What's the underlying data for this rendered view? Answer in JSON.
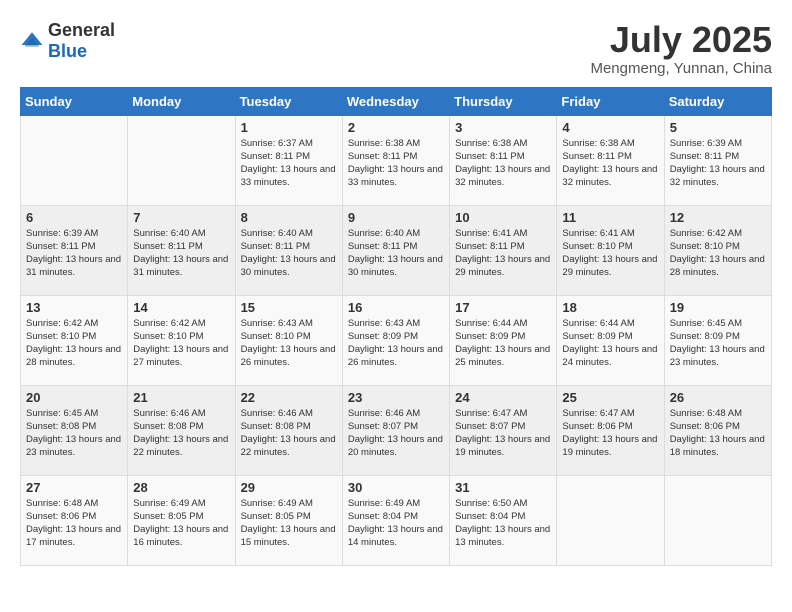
{
  "logo": {
    "general": "General",
    "blue": "Blue"
  },
  "header": {
    "month_year": "July 2025",
    "location": "Mengmeng, Yunnan, China"
  },
  "days_of_week": [
    "Sunday",
    "Monday",
    "Tuesday",
    "Wednesday",
    "Thursday",
    "Friday",
    "Saturday"
  ],
  "weeks": [
    [
      {
        "day": "",
        "sunrise": "",
        "sunset": "",
        "daylight": ""
      },
      {
        "day": "",
        "sunrise": "",
        "sunset": "",
        "daylight": ""
      },
      {
        "day": "1",
        "sunrise": "Sunrise: 6:37 AM",
        "sunset": "Sunset: 8:11 PM",
        "daylight": "Daylight: 13 hours and 33 minutes."
      },
      {
        "day": "2",
        "sunrise": "Sunrise: 6:38 AM",
        "sunset": "Sunset: 8:11 PM",
        "daylight": "Daylight: 13 hours and 33 minutes."
      },
      {
        "day": "3",
        "sunrise": "Sunrise: 6:38 AM",
        "sunset": "Sunset: 8:11 PM",
        "daylight": "Daylight: 13 hours and 32 minutes."
      },
      {
        "day": "4",
        "sunrise": "Sunrise: 6:38 AM",
        "sunset": "Sunset: 8:11 PM",
        "daylight": "Daylight: 13 hours and 32 minutes."
      },
      {
        "day": "5",
        "sunrise": "Sunrise: 6:39 AM",
        "sunset": "Sunset: 8:11 PM",
        "daylight": "Daylight: 13 hours and 32 minutes."
      }
    ],
    [
      {
        "day": "6",
        "sunrise": "Sunrise: 6:39 AM",
        "sunset": "Sunset: 8:11 PM",
        "daylight": "Daylight: 13 hours and 31 minutes."
      },
      {
        "day": "7",
        "sunrise": "Sunrise: 6:40 AM",
        "sunset": "Sunset: 8:11 PM",
        "daylight": "Daylight: 13 hours and 31 minutes."
      },
      {
        "day": "8",
        "sunrise": "Sunrise: 6:40 AM",
        "sunset": "Sunset: 8:11 PM",
        "daylight": "Daylight: 13 hours and 30 minutes."
      },
      {
        "day": "9",
        "sunrise": "Sunrise: 6:40 AM",
        "sunset": "Sunset: 8:11 PM",
        "daylight": "Daylight: 13 hours and 30 minutes."
      },
      {
        "day": "10",
        "sunrise": "Sunrise: 6:41 AM",
        "sunset": "Sunset: 8:11 PM",
        "daylight": "Daylight: 13 hours and 29 minutes."
      },
      {
        "day": "11",
        "sunrise": "Sunrise: 6:41 AM",
        "sunset": "Sunset: 8:10 PM",
        "daylight": "Daylight: 13 hours and 29 minutes."
      },
      {
        "day": "12",
        "sunrise": "Sunrise: 6:42 AM",
        "sunset": "Sunset: 8:10 PM",
        "daylight": "Daylight: 13 hours and 28 minutes."
      }
    ],
    [
      {
        "day": "13",
        "sunrise": "Sunrise: 6:42 AM",
        "sunset": "Sunset: 8:10 PM",
        "daylight": "Daylight: 13 hours and 28 minutes."
      },
      {
        "day": "14",
        "sunrise": "Sunrise: 6:42 AM",
        "sunset": "Sunset: 8:10 PM",
        "daylight": "Daylight: 13 hours and 27 minutes."
      },
      {
        "day": "15",
        "sunrise": "Sunrise: 6:43 AM",
        "sunset": "Sunset: 8:10 PM",
        "daylight": "Daylight: 13 hours and 26 minutes."
      },
      {
        "day": "16",
        "sunrise": "Sunrise: 6:43 AM",
        "sunset": "Sunset: 8:09 PM",
        "daylight": "Daylight: 13 hours and 26 minutes."
      },
      {
        "day": "17",
        "sunrise": "Sunrise: 6:44 AM",
        "sunset": "Sunset: 8:09 PM",
        "daylight": "Daylight: 13 hours and 25 minutes."
      },
      {
        "day": "18",
        "sunrise": "Sunrise: 6:44 AM",
        "sunset": "Sunset: 8:09 PM",
        "daylight": "Daylight: 13 hours and 24 minutes."
      },
      {
        "day": "19",
        "sunrise": "Sunrise: 6:45 AM",
        "sunset": "Sunset: 8:09 PM",
        "daylight": "Daylight: 13 hours and 23 minutes."
      }
    ],
    [
      {
        "day": "20",
        "sunrise": "Sunrise: 6:45 AM",
        "sunset": "Sunset: 8:08 PM",
        "daylight": "Daylight: 13 hours and 23 minutes."
      },
      {
        "day": "21",
        "sunrise": "Sunrise: 6:46 AM",
        "sunset": "Sunset: 8:08 PM",
        "daylight": "Daylight: 13 hours and 22 minutes."
      },
      {
        "day": "22",
        "sunrise": "Sunrise: 6:46 AM",
        "sunset": "Sunset: 8:08 PM",
        "daylight": "Daylight: 13 hours and 22 minutes."
      },
      {
        "day": "23",
        "sunrise": "Sunrise: 6:46 AM",
        "sunset": "Sunset: 8:07 PM",
        "daylight": "Daylight: 13 hours and 20 minutes."
      },
      {
        "day": "24",
        "sunrise": "Sunrise: 6:47 AM",
        "sunset": "Sunset: 8:07 PM",
        "daylight": "Daylight: 13 hours and 19 minutes."
      },
      {
        "day": "25",
        "sunrise": "Sunrise: 6:47 AM",
        "sunset": "Sunset: 8:06 PM",
        "daylight": "Daylight: 13 hours and 19 minutes."
      },
      {
        "day": "26",
        "sunrise": "Sunrise: 6:48 AM",
        "sunset": "Sunset: 8:06 PM",
        "daylight": "Daylight: 13 hours and 18 minutes."
      }
    ],
    [
      {
        "day": "27",
        "sunrise": "Sunrise: 6:48 AM",
        "sunset": "Sunset: 8:06 PM",
        "daylight": "Daylight: 13 hours and 17 minutes."
      },
      {
        "day": "28",
        "sunrise": "Sunrise: 6:49 AM",
        "sunset": "Sunset: 8:05 PM",
        "daylight": "Daylight: 13 hours and 16 minutes."
      },
      {
        "day": "29",
        "sunrise": "Sunrise: 6:49 AM",
        "sunset": "Sunset: 8:05 PM",
        "daylight": "Daylight: 13 hours and 15 minutes."
      },
      {
        "day": "30",
        "sunrise": "Sunrise: 6:49 AM",
        "sunset": "Sunset: 8:04 PM",
        "daylight": "Daylight: 13 hours and 14 minutes."
      },
      {
        "day": "31",
        "sunrise": "Sunrise: 6:50 AM",
        "sunset": "Sunset: 8:04 PM",
        "daylight": "Daylight: 13 hours and 13 minutes."
      },
      {
        "day": "",
        "sunrise": "",
        "sunset": "",
        "daylight": ""
      },
      {
        "day": "",
        "sunrise": "",
        "sunset": "",
        "daylight": ""
      }
    ]
  ]
}
